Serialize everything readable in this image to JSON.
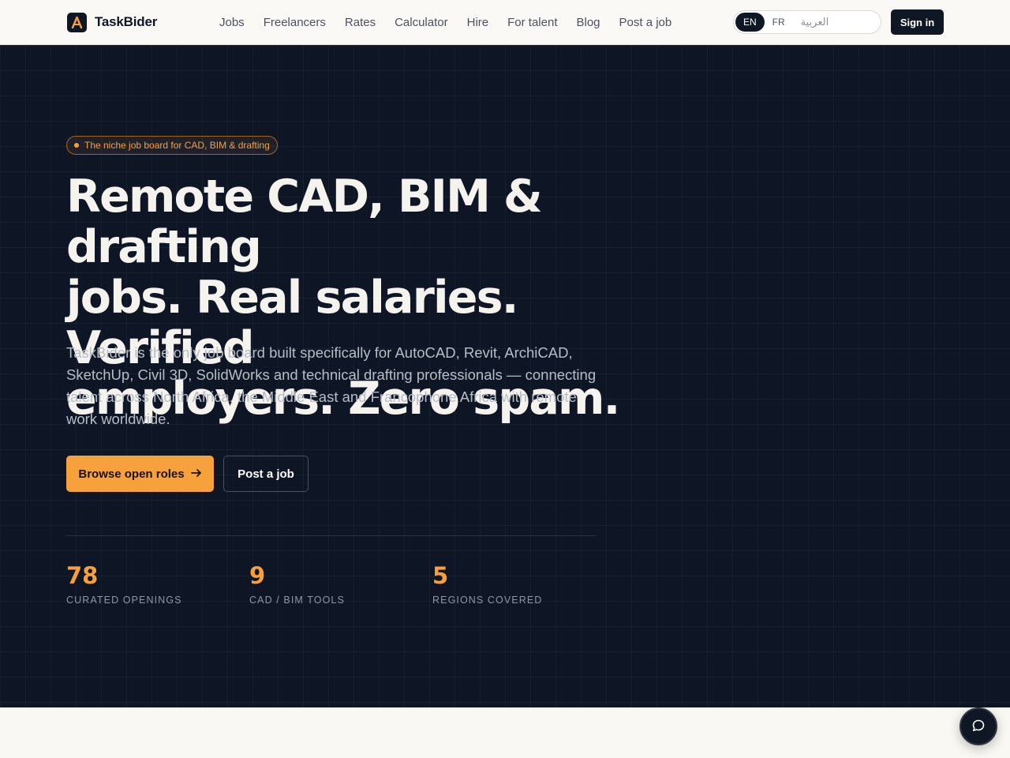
{
  "header": {
    "brand": "TaskBider",
    "nav": [
      "Jobs",
      "Freelancers",
      "Rates",
      "Calculator",
      "Hire",
      "For talent",
      "Blog",
      "Post a job"
    ],
    "languages": {
      "en": "EN",
      "fr": "FR",
      "ar": "العربية"
    },
    "active_language": "EN",
    "signin_label": "Sign in"
  },
  "hero": {
    "badge": "The niche job board for CAD, BIM & drafting",
    "headline_lines": [
      "Remote CAD, BIM & drafting",
      "jobs. Real salaries. Verified",
      "employers. Zero spam."
    ],
    "lede": "TaskBider is the only job board built specifically for AutoCAD, Revit, ArchiCAD, SketchUp, Civil 3D, SolidWorks and technical drafting professionals — connecting talent across North Africa, the Middle East and Francophone Africa with remote work worldwide.",
    "primary_cta": "Browse open roles",
    "primary_cta_icon": "arrow-right-icon",
    "secondary_cta": "Post a job",
    "stats": [
      {
        "value": "78",
        "label": "CURATED OPENINGS"
      },
      {
        "value": "9",
        "label": "CAD / BIM TOOLS"
      },
      {
        "value": "5",
        "label": "REGIONS COVERED"
      }
    ]
  },
  "chat": {
    "icon": "chat-bubble-icon"
  },
  "colors": {
    "hero_bg": "#0e1626",
    "accent": "#f7a13c",
    "header_bg": "#faf9f6",
    "dark": "#0f1624"
  }
}
